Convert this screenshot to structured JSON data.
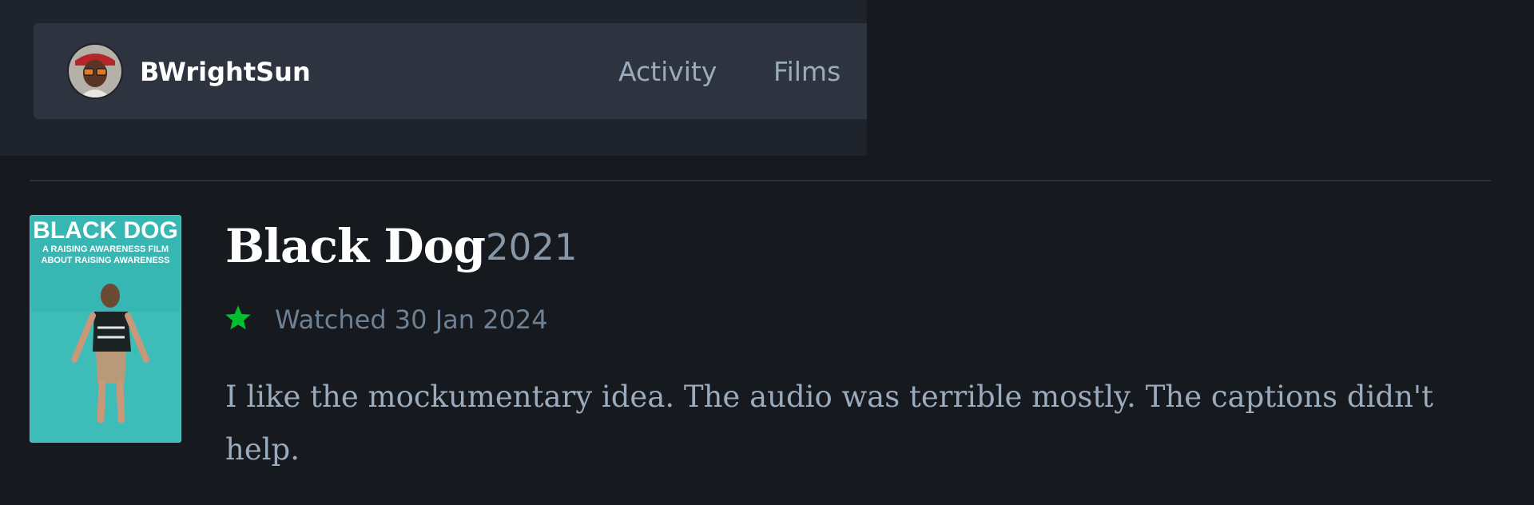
{
  "header": {
    "username": "BWrightSun",
    "nav": [
      {
        "label": "Activity"
      },
      {
        "label": "Films"
      }
    ]
  },
  "entry": {
    "poster": {
      "title_line": "BLACK DOG",
      "tagline_1": "A RAISING AWARENESS FILM",
      "tagline_2": "ABOUT RAISING AWARENESS"
    },
    "title": "Black Dog",
    "year": "2021",
    "rating_icon": "star-icon",
    "watched": "Watched 30 Jan 2024",
    "review": "I like the mockumentary idea. The audio was terrible mostly. The captions didn't help."
  },
  "colors": {
    "background": "#16191e",
    "header_band": "#1f242c",
    "nav_card": "#2d3440",
    "star": "#00c030",
    "poster_teal": "#2fb3b0"
  }
}
